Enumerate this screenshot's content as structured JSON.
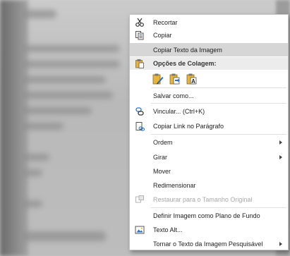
{
  "menu": {
    "items": [
      {
        "label": "Recortar",
        "icon": "scissors-icon"
      },
      {
        "label": "Copiar",
        "icon": "copy-icon"
      },
      {
        "label": "Copiar Texto da Imagem",
        "icon": "",
        "highlighted": true
      },
      {
        "label": "Opções de Colagem:",
        "icon": "paste-clipboard-icon",
        "header": true
      },
      {
        "label": "Salvar como...",
        "icon": ""
      },
      {
        "label": "Vincular...  (Ctrl+K)",
        "icon": "link-icon"
      },
      {
        "label": "Copiar Link no Parágrafo",
        "icon": "copy-link-icon"
      },
      {
        "label": "Ordem",
        "icon": "",
        "submenu": true
      },
      {
        "label": "Girar",
        "icon": "",
        "submenu": true
      },
      {
        "label": "Mover",
        "icon": ""
      },
      {
        "label": "Redimensionar",
        "icon": ""
      },
      {
        "label": "Restaurar para o Tamanho Original",
        "icon": "restore-size-icon",
        "disabled": true
      },
      {
        "label": "Definir Imagem como Plano de Fundo",
        "icon": ""
      },
      {
        "label": "Texto Alt...",
        "icon": "alt-text-icon"
      },
      {
        "label": "Tornar o Texto da Imagem Pesquisável",
        "icon": "",
        "submenu": true
      }
    ],
    "paste_options": [
      {
        "icon": "paste-keep-formatting-icon"
      },
      {
        "icon": "paste-merge-icon"
      },
      {
        "icon": "paste-text-only-icon"
      }
    ]
  },
  "colors": {
    "highlight": "#d6d6d6",
    "accent_blue": "#2f6fbf",
    "paste_yellow": "#e8b43a"
  }
}
